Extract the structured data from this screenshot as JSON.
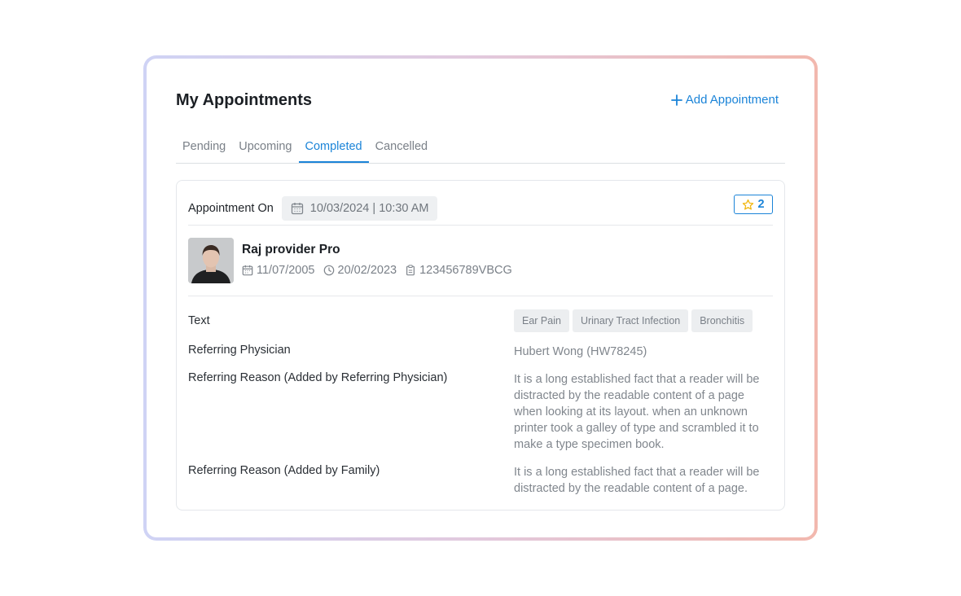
{
  "header": {
    "title": "My Appointments",
    "add_label": "Add Appointment"
  },
  "tabs": [
    {
      "label": "Pending"
    },
    {
      "label": "Upcoming"
    },
    {
      "label": "Completed"
    },
    {
      "label": "Cancelled"
    }
  ],
  "active_tab": "Completed",
  "appointment": {
    "on_label": "Appointment On",
    "datetime": "10/03/2024 | 10:30 AM",
    "star_count": "2",
    "provider": {
      "name": "Raj provider Pro",
      "dob": "11/07/2005",
      "last_visit": "20/02/2023",
      "id": "123456789VBCG"
    },
    "details": {
      "text_label": "Text",
      "tags": [
        "Ear Pain",
        "Urinary Tract Infection",
        "Bronchitis"
      ],
      "physician_label": "Referring Physician",
      "physician_value": "Hubert Wong (HW78245)",
      "reason_physician_label": "Referring Reason (Added by Referring Physician)",
      "reason_physician_value": "It is a long established fact that a reader will be distracted by the readable content of a page when looking at its layout. when an unknown printer took a galley of type and scrambled it to make a type specimen book.",
      "reason_family_label": "Referring Reason (Added by Family)",
      "reason_family_value": "It is a long established fact that a reader will be distracted by the readable content of a page."
    }
  },
  "colors": {
    "accent": "#1b84d8",
    "star": "#f2b70f"
  }
}
